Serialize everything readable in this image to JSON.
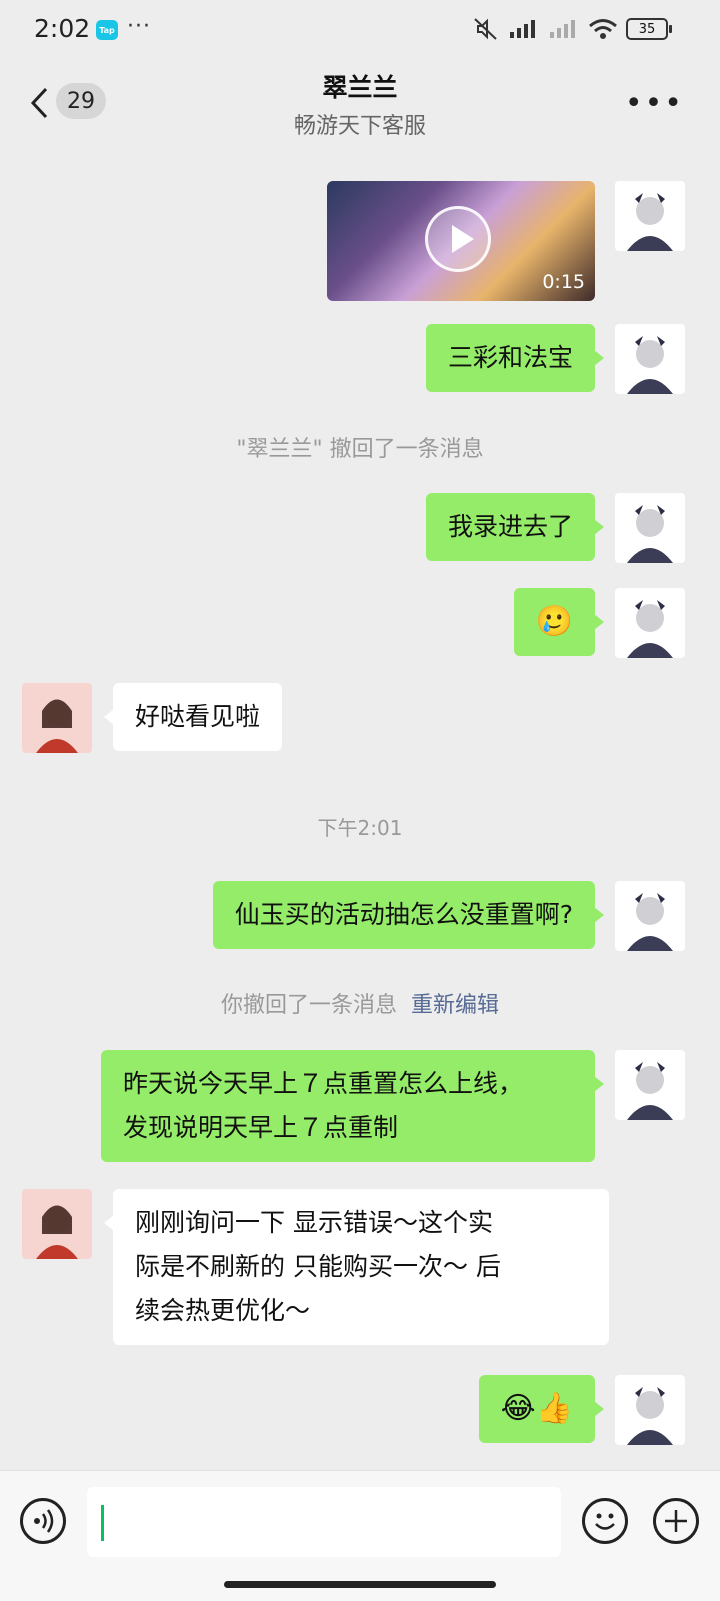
{
  "status_bar": {
    "time": "2:02",
    "tap_label": "Tap",
    "dots": "···",
    "battery": "35"
  },
  "nav": {
    "unread_count": "29",
    "title": "翠兰兰",
    "subtitle": "畅游天下客服"
  },
  "messages": [
    {
      "type": "video",
      "side": "self",
      "duration": "0:15"
    },
    {
      "type": "text",
      "side": "self",
      "text": "三彩和法宝"
    },
    {
      "type": "system",
      "text": "\"翠兰兰\" 撤回了一条消息"
    },
    {
      "type": "text",
      "side": "self",
      "text": "我录进去了"
    },
    {
      "type": "emoji",
      "side": "self",
      "text": "🥲"
    },
    {
      "type": "text",
      "side": "other",
      "text": "好哒看见啦"
    },
    {
      "type": "time",
      "text": "下午2:01"
    },
    {
      "type": "text",
      "side": "self",
      "text": "仙玉买的活动抽怎么没重置啊?"
    },
    {
      "type": "system",
      "text": "你撤回了一条消息",
      "link": "重新编辑"
    },
    {
      "type": "text",
      "side": "self",
      "line1": "昨天说今天早上７点重置怎么上线，",
      "line2": "发现说明天早上７点重制"
    },
    {
      "type": "text",
      "side": "other",
      "line1": "刚刚询问一下  显示错误～这个实",
      "line2": "际是不刷新的  只能购买一次～ 后",
      "line3": "续会热更优化～"
    },
    {
      "type": "emoji",
      "side": "self",
      "text": "😂👍"
    }
  ],
  "colors": {
    "self_bubble": "#95ec69",
    "other_bubble": "#ffffff",
    "background": "#ededed",
    "link": "#576b95"
  },
  "icons": [
    "back-chevron-icon",
    "more-icon",
    "voice-icon",
    "emoji-icon",
    "plus-icon",
    "play-icon"
  ]
}
